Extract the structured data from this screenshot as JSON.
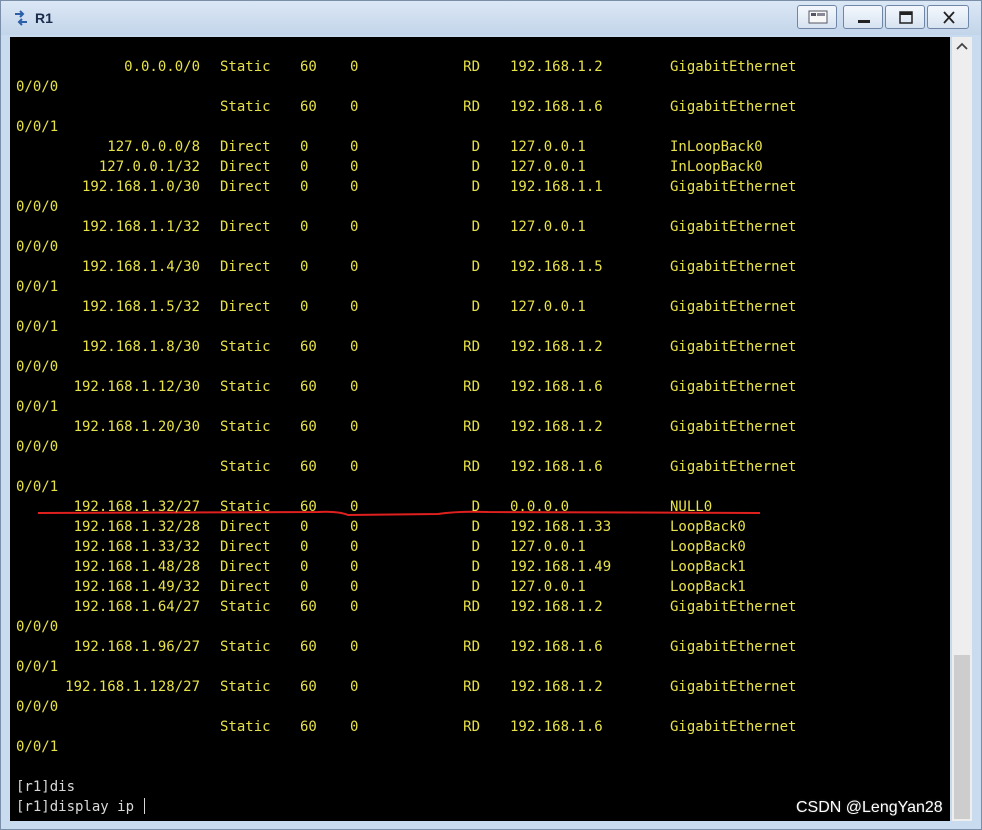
{
  "window": {
    "title": "R1"
  },
  "routes": [
    {
      "dest": "0.0.0.0/0",
      "proto": "Static",
      "pre": "60",
      "cost": "0",
      "flags": "RD",
      "nexthop": "192.168.1.2",
      "iface": "GigabitEthernet",
      "wrap": "0/0/0"
    },
    {
      "dest": "",
      "proto": "Static",
      "pre": "60",
      "cost": "0",
      "flags": "RD",
      "nexthop": "192.168.1.6",
      "iface": "GigabitEthernet",
      "wrap": "0/0/1"
    },
    {
      "dest": "127.0.0.0/8",
      "proto": "Direct",
      "pre": "0",
      "cost": "0",
      "flags": "D",
      "nexthop": "127.0.0.1",
      "iface": "InLoopBack0",
      "wrap": ""
    },
    {
      "dest": "127.0.0.1/32",
      "proto": "Direct",
      "pre": "0",
      "cost": "0",
      "flags": "D",
      "nexthop": "127.0.0.1",
      "iface": "InLoopBack0",
      "wrap": ""
    },
    {
      "dest": "192.168.1.0/30",
      "proto": "Direct",
      "pre": "0",
      "cost": "0",
      "flags": "D",
      "nexthop": "192.168.1.1",
      "iface": "GigabitEthernet",
      "wrap": "0/0/0"
    },
    {
      "dest": "192.168.1.1/32",
      "proto": "Direct",
      "pre": "0",
      "cost": "0",
      "flags": "D",
      "nexthop": "127.0.0.1",
      "iface": "GigabitEthernet",
      "wrap": "0/0/0"
    },
    {
      "dest": "192.168.1.4/30",
      "proto": "Direct",
      "pre": "0",
      "cost": "0",
      "flags": "D",
      "nexthop": "192.168.1.5",
      "iface": "GigabitEthernet",
      "wrap": "0/0/1"
    },
    {
      "dest": "192.168.1.5/32",
      "proto": "Direct",
      "pre": "0",
      "cost": "0",
      "flags": "D",
      "nexthop": "127.0.0.1",
      "iface": "GigabitEthernet",
      "wrap": "0/0/1"
    },
    {
      "dest": "192.168.1.8/30",
      "proto": "Static",
      "pre": "60",
      "cost": "0",
      "flags": "RD",
      "nexthop": "192.168.1.2",
      "iface": "GigabitEthernet",
      "wrap": "0/0/0"
    },
    {
      "dest": "192.168.1.12/30",
      "proto": "Static",
      "pre": "60",
      "cost": "0",
      "flags": "RD",
      "nexthop": "192.168.1.6",
      "iface": "GigabitEthernet",
      "wrap": "0/0/1"
    },
    {
      "dest": "192.168.1.20/30",
      "proto": "Static",
      "pre": "60",
      "cost": "0",
      "flags": "RD",
      "nexthop": "192.168.1.2",
      "iface": "GigabitEthernet",
      "wrap": "0/0/0"
    },
    {
      "dest": "",
      "proto": "Static",
      "pre": "60",
      "cost": "0",
      "flags": "RD",
      "nexthop": "192.168.1.6",
      "iface": "GigabitEthernet",
      "wrap": "0/0/1"
    },
    {
      "dest": "192.168.1.32/27",
      "proto": "Static",
      "pre": "60",
      "cost": "0",
      "flags": "D",
      "nexthop": "0.0.0.0",
      "iface": "NULL0",
      "wrap": ""
    },
    {
      "dest": "192.168.1.32/28",
      "proto": "Direct",
      "pre": "0",
      "cost": "0",
      "flags": "D",
      "nexthop": "192.168.1.33",
      "iface": "LoopBack0",
      "wrap": ""
    },
    {
      "dest": "192.168.1.33/32",
      "proto": "Direct",
      "pre": "0",
      "cost": "0",
      "flags": "D",
      "nexthop": "127.0.0.1",
      "iface": "LoopBack0",
      "wrap": ""
    },
    {
      "dest": "192.168.1.48/28",
      "proto": "Direct",
      "pre": "0",
      "cost": "0",
      "flags": "D",
      "nexthop": "192.168.1.49",
      "iface": "LoopBack1",
      "wrap": ""
    },
    {
      "dest": "192.168.1.49/32",
      "proto": "Direct",
      "pre": "0",
      "cost": "0",
      "flags": "D",
      "nexthop": "127.0.0.1",
      "iface": "LoopBack1",
      "wrap": ""
    },
    {
      "dest": "192.168.1.64/27",
      "proto": "Static",
      "pre": "60",
      "cost": "0",
      "flags": "RD",
      "nexthop": "192.168.1.2",
      "iface": "GigabitEthernet",
      "wrap": "0/0/0"
    },
    {
      "dest": "192.168.1.96/27",
      "proto": "Static",
      "pre": "60",
      "cost": "0",
      "flags": "RD",
      "nexthop": "192.168.1.6",
      "iface": "GigabitEthernet",
      "wrap": "0/0/1"
    },
    {
      "dest": "192.168.1.128/27",
      "proto": "Static",
      "pre": "60",
      "cost": "0",
      "flags": "RD",
      "nexthop": "192.168.1.2",
      "iface": "GigabitEthernet",
      "wrap": "0/0/0"
    },
    {
      "dest": "",
      "proto": "Static",
      "pre": "60",
      "cost": "0",
      "flags": "RD",
      "nexthop": "192.168.1.6",
      "iface": "GigabitEthernet",
      "wrap": "0/0/1"
    }
  ],
  "commands": [
    "[r1]dis",
    "[r1]display ip "
  ],
  "watermark": "CSDN @LengYan28",
  "colors": {
    "terminal_bg": "#000000",
    "text": "#e8e24a",
    "annotation": "#e0201e"
  },
  "icons": {
    "app": "router-icon",
    "minimize": "minimize-icon",
    "maximize": "maximize-icon",
    "close": "close-icon",
    "restore": "restore-icon",
    "scroll_up": "chevron-up-icon"
  }
}
